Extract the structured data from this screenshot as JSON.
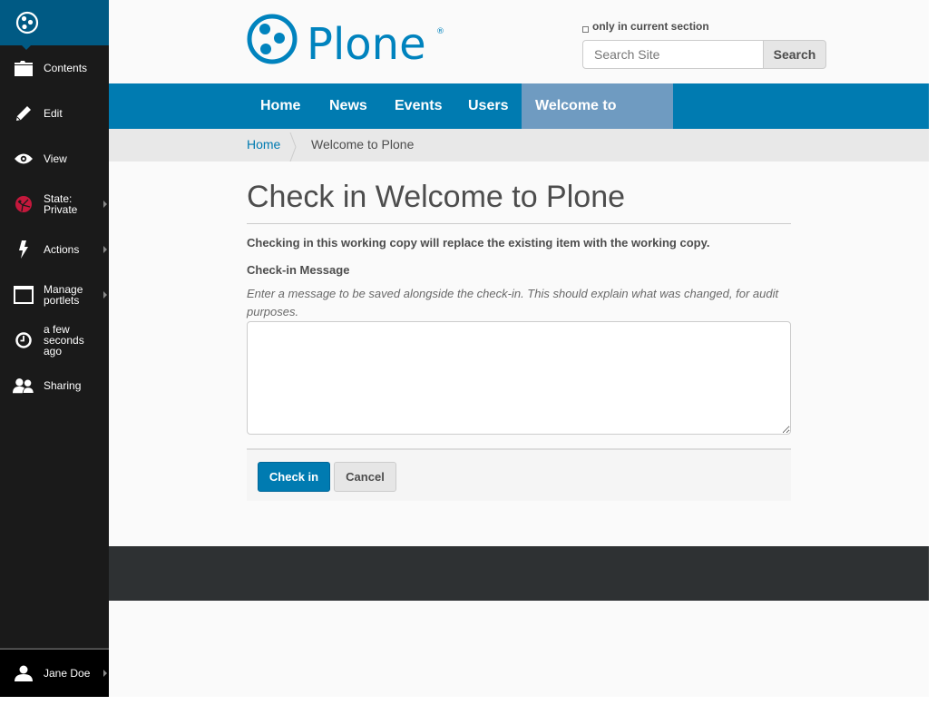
{
  "toolbar": {
    "items": [
      {
        "label": "Contents",
        "icon": "folder-icon"
      },
      {
        "label": "Edit",
        "icon": "pencil-icon"
      },
      {
        "label": "View",
        "icon": "eye-icon"
      },
      {
        "label": "State: Private",
        "line1": "State:",
        "line2": "Private",
        "icon": "state-icon"
      },
      {
        "label": "Actions",
        "icon": "lightning-icon"
      },
      {
        "label": "Manage portlets",
        "line1": "Manage",
        "line2": "portlets",
        "icon": "window-icon"
      },
      {
        "label": "a few seconds ago",
        "line1": "a few",
        "line2": "seconds",
        "line3": "ago",
        "icon": "clock-icon"
      },
      {
        "label": "Sharing",
        "icon": "users-icon"
      }
    ],
    "user": {
      "label": "Jane Doe",
      "icon": "user-icon"
    }
  },
  "header": {
    "logo_text": "Plone",
    "search": {
      "section_label": "only in current section",
      "placeholder": "Search Site",
      "value": "",
      "button_label": "Search"
    }
  },
  "nav": {
    "items": [
      {
        "label": "Home",
        "active": false
      },
      {
        "label": "News",
        "active": false
      },
      {
        "label": "Events",
        "active": false
      },
      {
        "label": "Users",
        "active": false
      },
      {
        "label": "Welcome to Plone",
        "active": true
      }
    ]
  },
  "breadcrumbs": {
    "home": "Home",
    "current": "Welcome to Plone"
  },
  "main": {
    "title": "Check in Welcome to Plone",
    "description": "Checking in this working copy will replace the existing item with the working copy.",
    "field_label": "Check-in Message",
    "field_help": "Enter a message to be saved alongside the check-in. This should explain what was changed, for audit purposes.",
    "field_value": "",
    "checkin_label": "Check in",
    "cancel_label": "Cancel"
  },
  "colors": {
    "brand": "#007bb1",
    "toolbar_logo_bg": "#005a84",
    "toolbar_bg": "#1a1a1a",
    "nav_active": "#6f9bc1",
    "state_private": "#c4183c",
    "footer": "#2e3133"
  }
}
